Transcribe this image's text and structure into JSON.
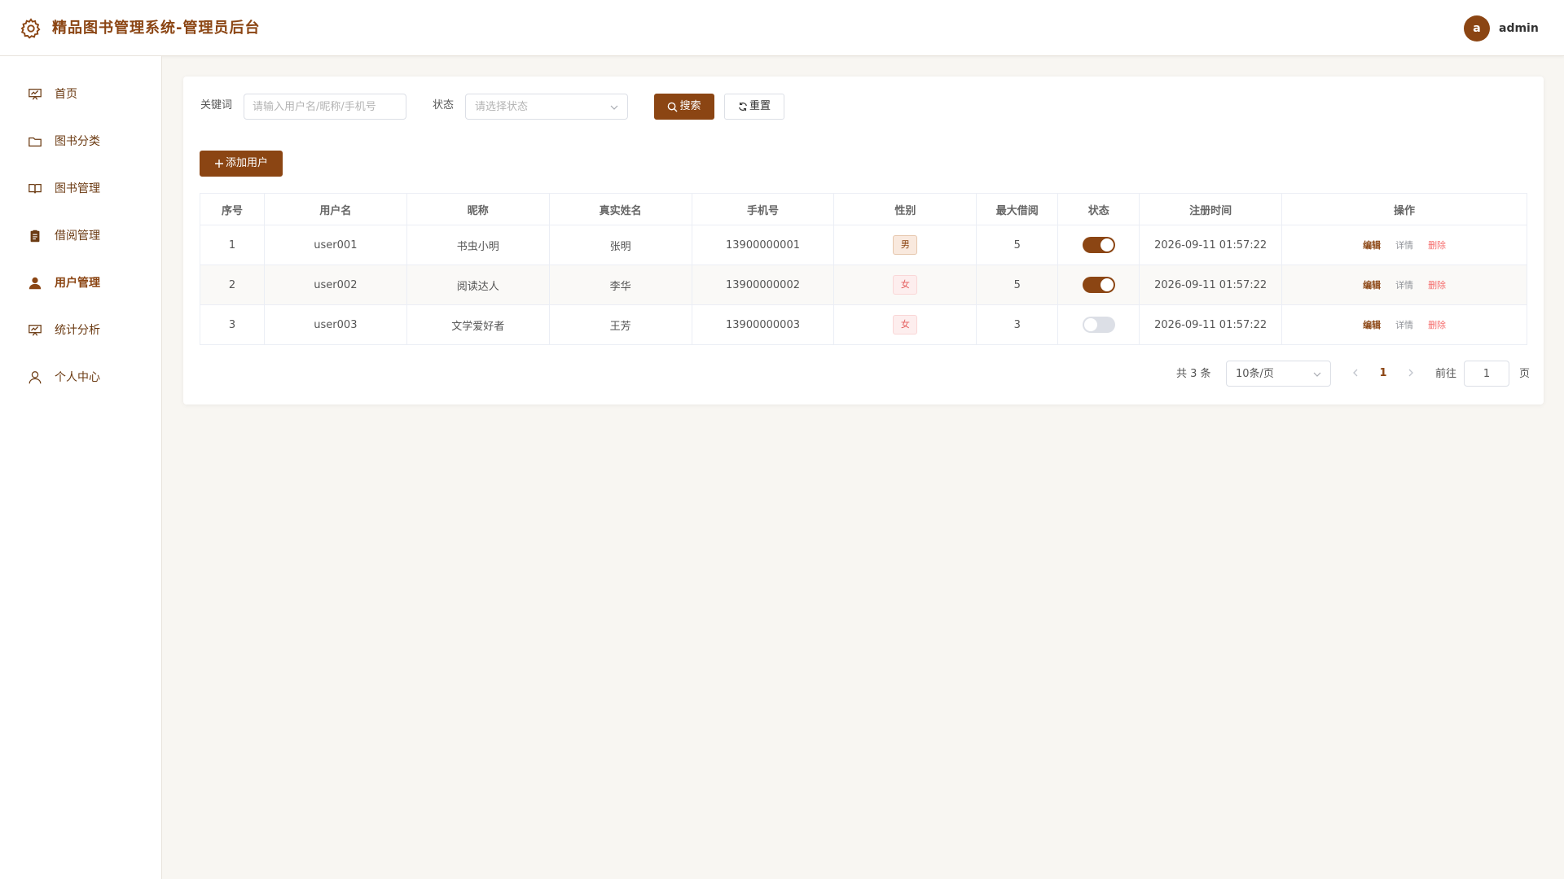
{
  "header": {
    "title": "精品图书管理系统-管理员后台",
    "avatar_letter": "a",
    "username": "admin"
  },
  "theme": {
    "accent": "#8b4513",
    "danger": "#f56c6c",
    "background": "#f8f6f2"
  },
  "sidebar": {
    "items": [
      {
        "label": "首页",
        "icon": "presentation-chart-icon",
        "active": false
      },
      {
        "label": "图书分类",
        "icon": "folder-icon",
        "active": false
      },
      {
        "label": "图书管理",
        "icon": "open-book-icon",
        "active": false
      },
      {
        "label": "借阅管理",
        "icon": "clipboard-icon",
        "active": false
      },
      {
        "label": "用户管理",
        "icon": "user-filled-icon",
        "active": true
      },
      {
        "label": "统计分析",
        "icon": "presentation-chart-icon",
        "active": false
      },
      {
        "label": "个人中心",
        "icon": "user-outline-icon",
        "active": false
      }
    ]
  },
  "filters": {
    "keyword_label": "关键词",
    "keyword_value": "",
    "keyword_placeholder": "请输入用户名/昵称/手机号",
    "status_label": "状态",
    "status_placeholder": "请选择状态",
    "search_button": "搜索",
    "reset_button": "重置"
  },
  "toolbar": {
    "add_button": "添加用户"
  },
  "table": {
    "columns": [
      "序号",
      "用户名",
      "昵称",
      "真实姓名",
      "手机号",
      "性别",
      "最大借阅",
      "状态",
      "注册时间",
      "操作"
    ],
    "rows": [
      {
        "index": "1",
        "username": "user001",
        "nickname": "书虫小明",
        "real_name": "张明",
        "phone": "13900000001",
        "gender": "男",
        "max_borrow": "5",
        "enabled": true,
        "registered_at": "2026-09-11 01:57:22"
      },
      {
        "index": "2",
        "username": "user002",
        "nickname": "阅读达人",
        "real_name": "李华",
        "phone": "13900000002",
        "gender": "女",
        "max_borrow": "5",
        "enabled": true,
        "registered_at": "2026-09-11 01:57:22"
      },
      {
        "index": "3",
        "username": "user003",
        "nickname": "文学爱好者",
        "real_name": "王芳",
        "phone": "13900000003",
        "gender": "女",
        "max_borrow": "3",
        "enabled": false,
        "registered_at": "2026-09-11 01:57:22"
      }
    ],
    "actions": {
      "edit": "编辑",
      "detail": "详情",
      "delete": "删除"
    }
  },
  "pagination": {
    "total_text": "共 3 条",
    "page_size": "10条/页",
    "current_page": "1",
    "goto_label": "前往",
    "goto_value": "1",
    "page_suffix": "页"
  }
}
